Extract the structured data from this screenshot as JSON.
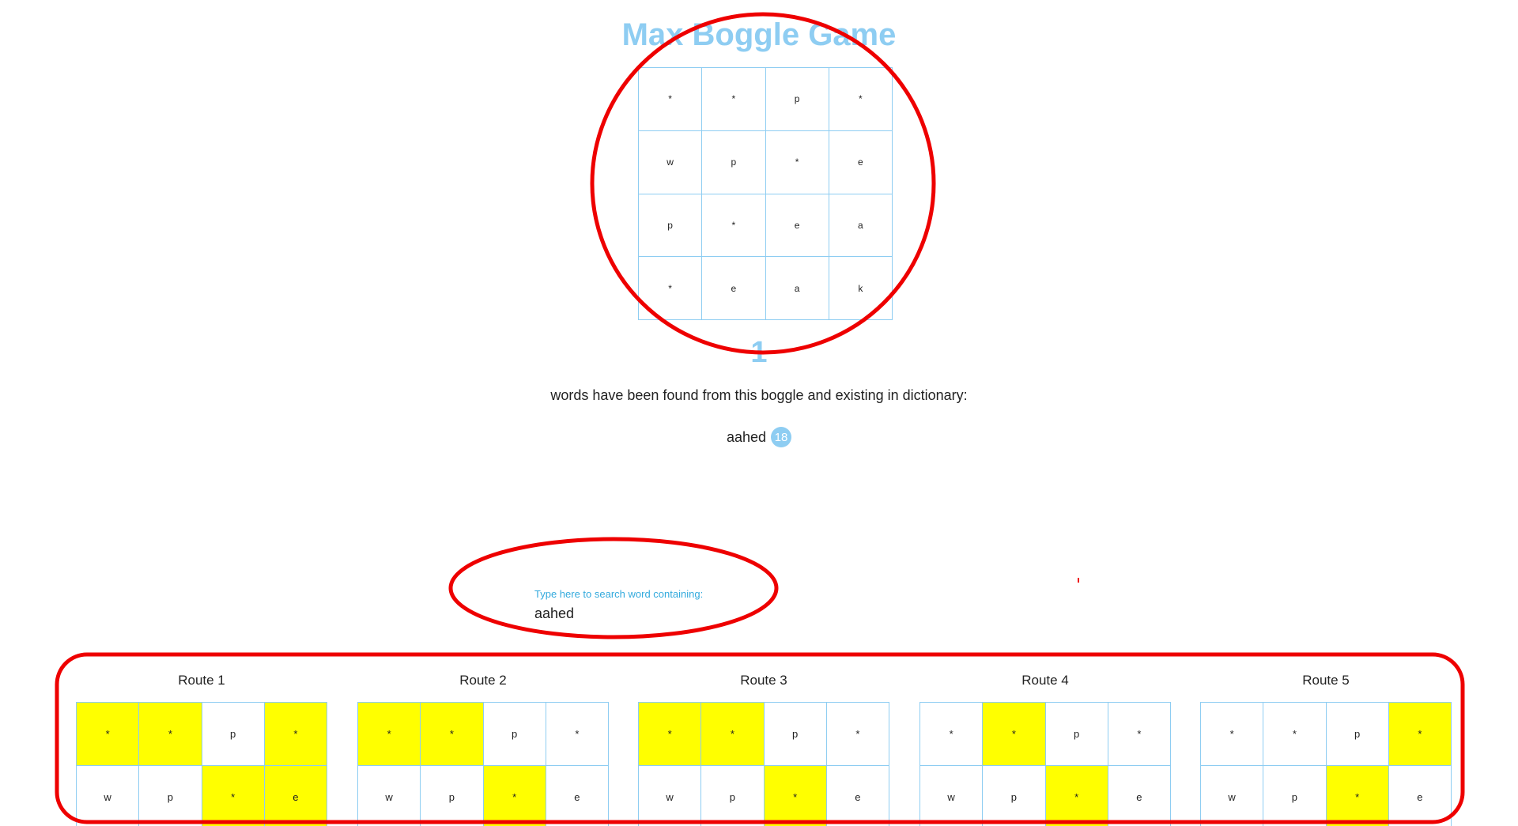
{
  "app": {
    "title": "Max Boggle Game"
  },
  "board": {
    "rows": [
      [
        "*",
        "*",
        "p",
        "*"
      ],
      [
        "w",
        "p",
        "*",
        "e"
      ],
      [
        "p",
        "*",
        "e",
        "a"
      ],
      [
        "*",
        "e",
        "a",
        "k"
      ]
    ]
  },
  "results": {
    "count": "1",
    "description": "words have been found from this boggle and existing in dictionary:",
    "words": [
      {
        "word": "aahed",
        "count": "18"
      }
    ]
  },
  "search": {
    "label": "Type here to search word containing:",
    "value": "aahed"
  },
  "routes": [
    {
      "label": "Route 1",
      "rows": [
        [
          "*",
          "*",
          "p",
          "*"
        ],
        [
          "w",
          "p",
          "*",
          "e"
        ]
      ],
      "highlight": [
        [
          true,
          true,
          false,
          true
        ],
        [
          false,
          false,
          true,
          true
        ]
      ]
    },
    {
      "label": "Route 2",
      "rows": [
        [
          "*",
          "*",
          "p",
          "*"
        ],
        [
          "w",
          "p",
          "*",
          "e"
        ]
      ],
      "highlight": [
        [
          true,
          true,
          false,
          false
        ],
        [
          false,
          false,
          true,
          false
        ]
      ]
    },
    {
      "label": "Route 3",
      "rows": [
        [
          "*",
          "*",
          "p",
          "*"
        ],
        [
          "w",
          "p",
          "*",
          "e"
        ]
      ],
      "highlight": [
        [
          true,
          true,
          false,
          false
        ],
        [
          false,
          false,
          true,
          false
        ]
      ]
    },
    {
      "label": "Route 4",
      "rows": [
        [
          "*",
          "*",
          "p",
          "*"
        ],
        [
          "w",
          "p",
          "*",
          "e"
        ]
      ],
      "highlight": [
        [
          false,
          true,
          false,
          false
        ],
        [
          false,
          false,
          true,
          false
        ]
      ]
    },
    {
      "label": "Route 5",
      "rows": [
        [
          "*",
          "*",
          "p",
          "*"
        ],
        [
          "w",
          "p",
          "*",
          "e"
        ]
      ],
      "highlight": [
        [
          false,
          false,
          false,
          true
        ],
        [
          false,
          false,
          true,
          false
        ]
      ]
    }
  ],
  "colors": {
    "accent": "#8ecdf2",
    "highlight": "#ffff00",
    "annotation": "#ee0000",
    "label": "#33aadd"
  }
}
